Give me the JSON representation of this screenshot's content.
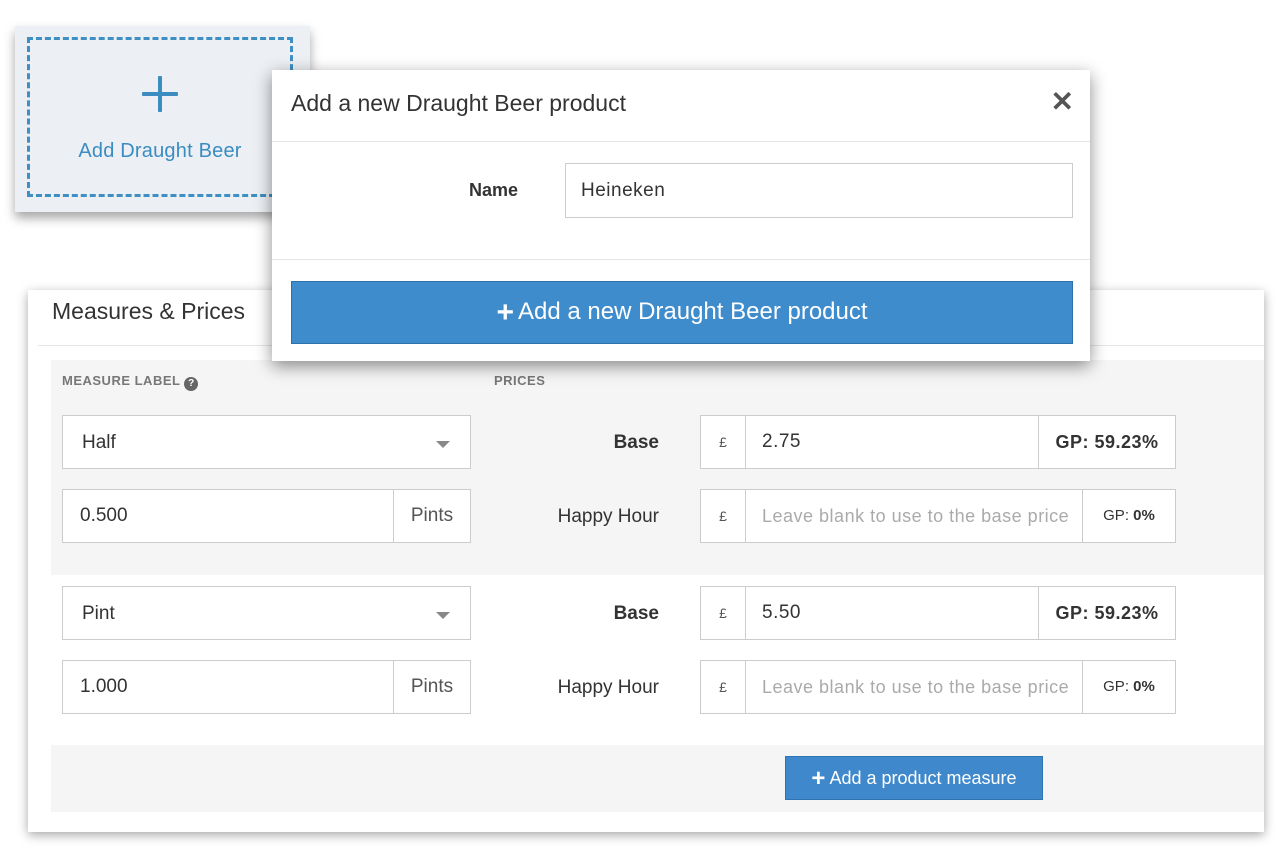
{
  "tile": {
    "label": "Add Draught Beer",
    "icon": "plus-icon"
  },
  "panel": {
    "title": "Measures & Prices",
    "headers": {
      "measure_label": "MEASURE LABEL",
      "help_glyph": "?",
      "prices": "PRICES"
    },
    "measures": [
      {
        "label": "Half",
        "quantity": "0.500",
        "unit": "Pints",
        "base_label": "Base",
        "base_currency": "£",
        "base_price": "2.75",
        "base_gp": "GP: 59.23%",
        "hh_label": "Happy Hour",
        "hh_currency": "£",
        "hh_placeholder": "Leave blank to use to the base price",
        "hh_gp_prefix": "GP:",
        "hh_gp_value": "0%"
      },
      {
        "label": "Pint",
        "quantity": "1.000",
        "unit": "Pints",
        "base_label": "Base",
        "base_currency": "£",
        "base_price": "5.50",
        "base_gp": "GP: 59.23%",
        "hh_label": "Happy Hour",
        "hh_currency": "£",
        "hh_placeholder": "Leave blank to use to the base price",
        "hh_gp_prefix": "GP:",
        "hh_gp_value": "0%"
      }
    ],
    "add_measure": {
      "plus": "+",
      "label": "Add a product measure"
    }
  },
  "modal": {
    "title": "Add a new Draught Beer product",
    "close_glyph": "✕",
    "name_label": "Name",
    "name_value": "Heineken",
    "submit_plus": "+",
    "submit_label": "Add a new Draught Beer product"
  },
  "colors": {
    "accent": "#3f8ccd",
    "tile_accent": "#3a8cc1"
  }
}
